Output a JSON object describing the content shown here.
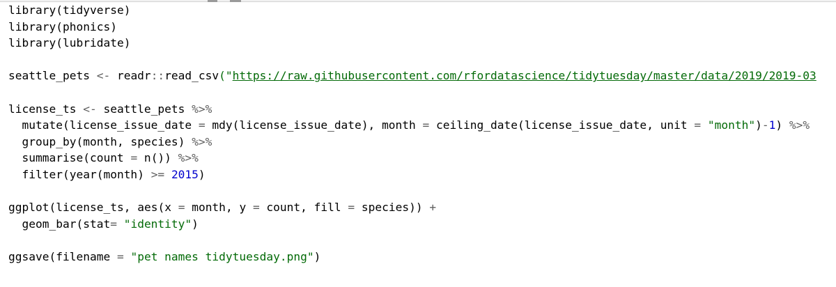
{
  "editor": {
    "language": "R",
    "colors": {
      "background": "#ffffff",
      "default": "#000000",
      "operator": "#5f5f5f",
      "string": "#036a07",
      "number": "#0000cd"
    },
    "lines": [
      [
        {
          "t": "library",
          "k": "fn"
        },
        {
          "t": "(",
          "k": "plain"
        },
        {
          "t": "tidyverse",
          "k": "id"
        },
        {
          "t": ")",
          "k": "plain"
        }
      ],
      [
        {
          "t": "library",
          "k": "fn"
        },
        {
          "t": "(",
          "k": "plain"
        },
        {
          "t": "phonics",
          "k": "id"
        },
        {
          "t": ")",
          "k": "plain"
        }
      ],
      [
        {
          "t": "library",
          "k": "fn"
        },
        {
          "t": "(",
          "k": "plain"
        },
        {
          "t": "lubridate",
          "k": "id"
        },
        {
          "t": ")",
          "k": "plain"
        }
      ],
      [],
      [
        {
          "t": "seattle_pets ",
          "k": "id"
        },
        {
          "t": "<-",
          "k": "op"
        },
        {
          "t": " readr",
          "k": "id"
        },
        {
          "t": "::",
          "k": "op"
        },
        {
          "t": "read_csv",
          "k": "fn"
        },
        {
          "t": "(\"",
          "k": "str"
        },
        {
          "t": "https://raw.githubusercontent.com/rfordatascience/tidytuesday/master/data/2019/2019-03",
          "k": "url"
        }
      ],
      [],
      [
        {
          "t": "license_ts ",
          "k": "id"
        },
        {
          "t": "<-",
          "k": "op"
        },
        {
          "t": " seattle_pets ",
          "k": "id"
        },
        {
          "t": "%>%",
          "k": "op"
        }
      ],
      [
        {
          "t": "  mutate",
          "k": "fn"
        },
        {
          "t": "(",
          "k": "plain"
        },
        {
          "t": "license_issue_date ",
          "k": "id"
        },
        {
          "t": "=",
          "k": "op"
        },
        {
          "t": " mdy",
          "k": "fn"
        },
        {
          "t": "(",
          "k": "plain"
        },
        {
          "t": "license_issue_date",
          "k": "id"
        },
        {
          "t": "), ",
          "k": "plain"
        },
        {
          "t": "month ",
          "k": "id"
        },
        {
          "t": "=",
          "k": "op"
        },
        {
          "t": " ceiling_date",
          "k": "fn"
        },
        {
          "t": "(",
          "k": "plain"
        },
        {
          "t": "license_issue_date",
          "k": "id"
        },
        {
          "t": ", ",
          "k": "plain"
        },
        {
          "t": "unit ",
          "k": "id"
        },
        {
          "t": "=",
          "k": "op"
        },
        {
          "t": " ",
          "k": "plain"
        },
        {
          "t": "\"month\"",
          "k": "str"
        },
        {
          "t": ")",
          "k": "plain"
        },
        {
          "t": "-",
          "k": "op"
        },
        {
          "t": "1",
          "k": "num"
        },
        {
          "t": ") ",
          "k": "plain"
        },
        {
          "t": "%>%",
          "k": "op"
        }
      ],
      [
        {
          "t": "  group_by",
          "k": "fn"
        },
        {
          "t": "(",
          "k": "plain"
        },
        {
          "t": "month",
          "k": "id"
        },
        {
          "t": ", ",
          "k": "plain"
        },
        {
          "t": "species",
          "k": "id"
        },
        {
          "t": ") ",
          "k": "plain"
        },
        {
          "t": "%>%",
          "k": "op"
        }
      ],
      [
        {
          "t": "  summarise",
          "k": "fn"
        },
        {
          "t": "(",
          "k": "plain"
        },
        {
          "t": "count ",
          "k": "id"
        },
        {
          "t": "=",
          "k": "op"
        },
        {
          "t": " n",
          "k": "fn"
        },
        {
          "t": "()) ",
          "k": "plain"
        },
        {
          "t": "%>%",
          "k": "op"
        }
      ],
      [
        {
          "t": "  filter",
          "k": "fn"
        },
        {
          "t": "(",
          "k": "plain"
        },
        {
          "t": "year",
          "k": "fn"
        },
        {
          "t": "(",
          "k": "plain"
        },
        {
          "t": "month",
          "k": "id"
        },
        {
          "t": ") ",
          "k": "plain"
        },
        {
          "t": ">=",
          "k": "op"
        },
        {
          "t": " ",
          "k": "plain"
        },
        {
          "t": "2015",
          "k": "num"
        },
        {
          "t": ")",
          "k": "plain"
        }
      ],
      [],
      [
        {
          "t": "ggplot",
          "k": "fn"
        },
        {
          "t": "(",
          "k": "plain"
        },
        {
          "t": "license_ts",
          "k": "id"
        },
        {
          "t": ", ",
          "k": "plain"
        },
        {
          "t": "aes",
          "k": "fn"
        },
        {
          "t": "(",
          "k": "plain"
        },
        {
          "t": "x ",
          "k": "id"
        },
        {
          "t": "=",
          "k": "op"
        },
        {
          "t": " month",
          "k": "id"
        },
        {
          "t": ", ",
          "k": "plain"
        },
        {
          "t": "y ",
          "k": "id"
        },
        {
          "t": "=",
          "k": "op"
        },
        {
          "t": " count",
          "k": "id"
        },
        {
          "t": ", ",
          "k": "plain"
        },
        {
          "t": "fill ",
          "k": "id"
        },
        {
          "t": "=",
          "k": "op"
        },
        {
          "t": " species",
          "k": "id"
        },
        {
          "t": ")) ",
          "k": "plain"
        },
        {
          "t": "+",
          "k": "op"
        }
      ],
      [
        {
          "t": "  geom_bar",
          "k": "fn"
        },
        {
          "t": "(",
          "k": "plain"
        },
        {
          "t": "stat",
          "k": "id"
        },
        {
          "t": "=",
          "k": "op"
        },
        {
          "t": " ",
          "k": "plain"
        },
        {
          "t": "\"identity\"",
          "k": "str"
        },
        {
          "t": ")",
          "k": "plain"
        }
      ],
      [],
      [
        {
          "t": "ggsave",
          "k": "fn"
        },
        {
          "t": "(",
          "k": "plain"
        },
        {
          "t": "filename ",
          "k": "id"
        },
        {
          "t": "=",
          "k": "op"
        },
        {
          "t": " ",
          "k": "plain"
        },
        {
          "t": "\"pet names tidytuesday.png\"",
          "k": "str"
        },
        {
          "t": ")",
          "k": "plain"
        }
      ]
    ]
  }
}
